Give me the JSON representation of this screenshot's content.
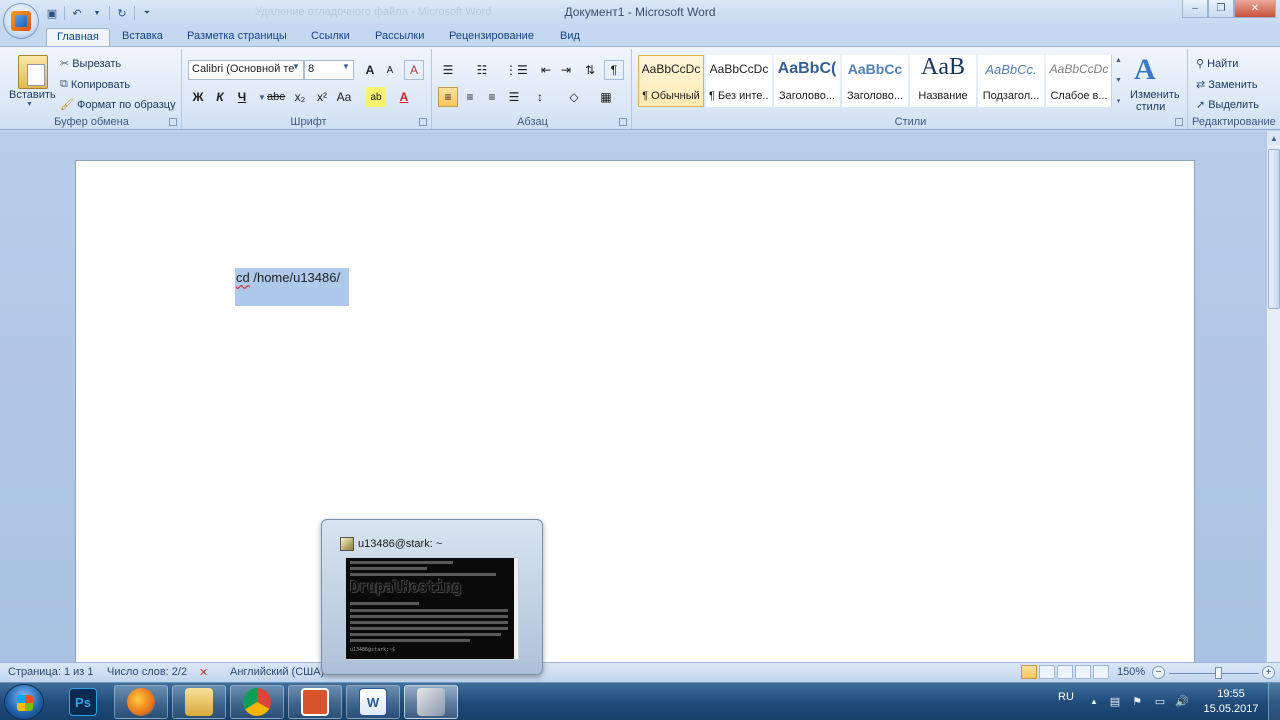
{
  "window": {
    "title": "Документ1 - Microsoft Word",
    "ghost_title": "Удаление отладочного файла - Microsoft Word",
    "controls": [
      "–",
      "❐",
      "✕"
    ]
  },
  "qat": [
    "save-icon",
    "undo-icon",
    "redo-icon",
    "customize-icon"
  ],
  "tabs": [
    {
      "label": "Главная",
      "active": true
    },
    {
      "label": "Вставка"
    },
    {
      "label": "Разметка страницы"
    },
    {
      "label": "Ссылки"
    },
    {
      "label": "Рассылки"
    },
    {
      "label": "Рецензирование"
    },
    {
      "label": "Вид"
    }
  ],
  "clipboard": {
    "paste": "Вставить",
    "cut": "Вырезать",
    "copy": "Копировать",
    "format_painter": "Формат по образцу",
    "group_label": "Буфер обмена"
  },
  "font": {
    "name": "Calibri (Основной те",
    "size": "8",
    "group_label": "Шрифт",
    "bold": "Ж",
    "italic": "К",
    "underline": "Ч",
    "strike": "abe",
    "sub": "x₂",
    "sup": "x²",
    "case": "Aa",
    "grow": "A",
    "shrink": "A",
    "clear": "A"
  },
  "paragraph": {
    "group_label": "Абзац",
    "pilcrow": "¶"
  },
  "styles": {
    "group_label": "Стили",
    "items": [
      {
        "preview": "AaBbCcDc",
        "name": "¶ Обычный",
        "selected": true
      },
      {
        "preview": "AaBbCcDc",
        "name": "¶ Без инте..."
      },
      {
        "preview": "AaBbC(",
        "name": "Заголово..."
      },
      {
        "preview": "AaBbCc",
        "name": "Заголово..."
      },
      {
        "preview": "AaB",
        "name": "Название"
      },
      {
        "preview": "AaBbCc.",
        "name": "Подзагол..."
      },
      {
        "preview": "AaBbCcDc",
        "name": "Слабое в..."
      }
    ],
    "change_styles_line1": "Изменить",
    "change_styles_line2": "стили"
  },
  "editing": {
    "find": "Найти",
    "replace": "Заменить",
    "select": "Выделить",
    "group_label": "Редактирование"
  },
  "document": {
    "text_part1": "cd",
    "text_part2": " /home/u13486/"
  },
  "statusbar": {
    "page": "Страница: 1 из 1",
    "words": "Число слов: 2/2",
    "language": "Английский (США)",
    "zoom": "150%"
  },
  "preview": {
    "title": "u13486@stark: ~",
    "banner": "DrupalHosting",
    "prompt": "u13486@stark:~$"
  },
  "taskbar": {
    "apps": [
      {
        "name": "photoshop",
        "label": "Ps",
        "color": "#0a2a4f",
        "fg": "#2fa3e6"
      },
      {
        "name": "firefox",
        "label": "",
        "color": "#e8761c"
      },
      {
        "name": "explorer",
        "label": "",
        "color": "#e9c75a"
      },
      {
        "name": "chrome",
        "label": "",
        "color": "#3a9b3a"
      },
      {
        "name": "app-red",
        "label": "",
        "color": "#d9542c"
      },
      {
        "name": "word",
        "label": "W",
        "color": "#2b5797"
      },
      {
        "name": "putty",
        "label": "",
        "color": "#5a6b8a"
      }
    ],
    "lang": "RU",
    "time": "19:55",
    "date": "15.05.2017"
  }
}
